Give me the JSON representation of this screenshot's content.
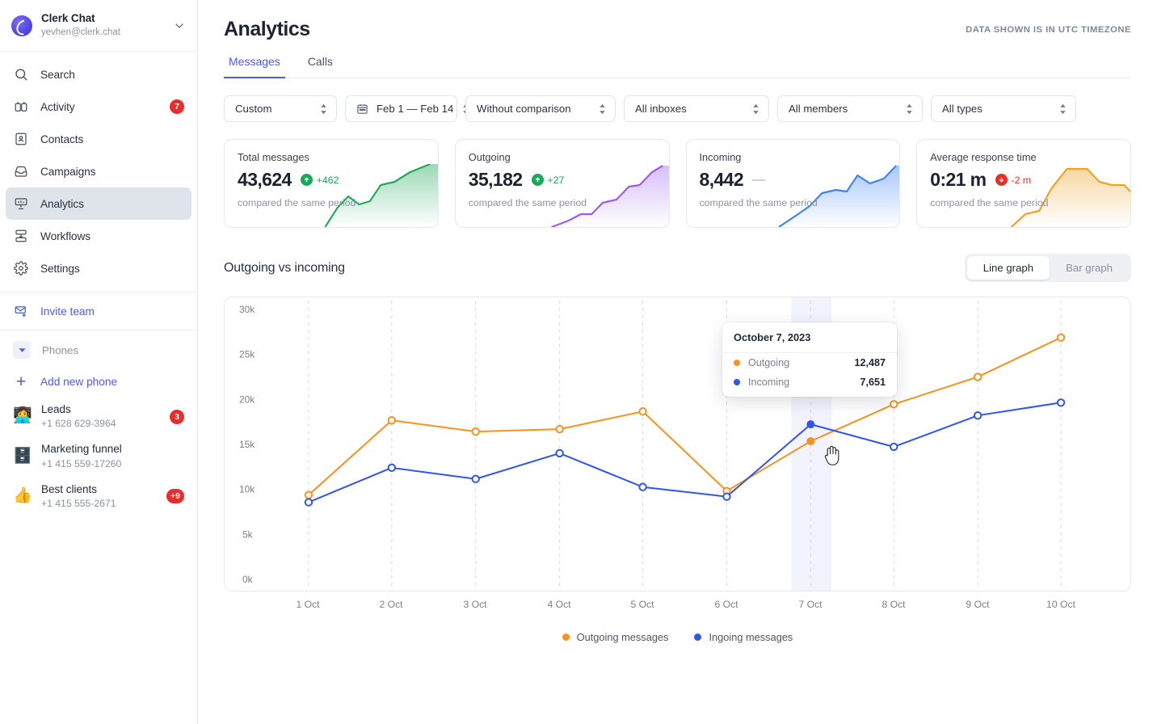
{
  "sidebar": {
    "workspace": {
      "name": "Clerk Chat",
      "email": "yevhen@clerk.chat",
      "logo_icon": "clerk-logo",
      "chevron_icon": "chevron-down-icon"
    },
    "items": [
      {
        "label": "Search",
        "icon": "search-icon",
        "badge": ""
      },
      {
        "label": "Activity",
        "icon": "activity-icon",
        "badge": "7"
      },
      {
        "label": "Contacts",
        "icon": "contacts-icon",
        "badge": ""
      },
      {
        "label": "Campaigns",
        "icon": "campaigns-icon",
        "badge": ""
      },
      {
        "label": "Analytics",
        "icon": "analytics-icon",
        "badge": "",
        "active": true
      },
      {
        "label": "Workflows",
        "icon": "workflows-icon",
        "badge": ""
      },
      {
        "label": "Settings",
        "icon": "settings-icon",
        "badge": ""
      }
    ],
    "invite": {
      "label": "Invite team",
      "icon": "mail-add-icon"
    },
    "phones_header": {
      "label": "Phones",
      "icon": "caret-down-icon"
    },
    "add_phone": {
      "label": "Add new phone",
      "icon": "plus-icon"
    },
    "phones": [
      {
        "emoji": "👩‍💻",
        "name": "Leads",
        "number": "+1 628 629-3964",
        "badge": "3"
      },
      {
        "emoji": "🗄️",
        "name": "Marketing funnel",
        "number": "+1 415 559-17260",
        "badge": ""
      },
      {
        "emoji": "👍",
        "name": "Best clients",
        "number": "+1 415 555-2671",
        "badge": "+9"
      }
    ]
  },
  "header": {
    "title": "Analytics",
    "utc_note": "DATA SHOWN IS IN UTC TIMEZONE",
    "tabs": [
      {
        "label": "Messages",
        "active": true
      },
      {
        "label": "Calls",
        "active": false
      }
    ]
  },
  "filters": [
    {
      "name": "range",
      "value": "Custom",
      "icon": ""
    },
    {
      "name": "date",
      "value": "Feb 1 — Feb 14",
      "icon": "calendar-icon"
    },
    {
      "name": "comparison",
      "value": "Without comparison",
      "icon": ""
    },
    {
      "name": "inboxes",
      "value": "All inboxes",
      "icon": ""
    },
    {
      "name": "members",
      "value": "All members",
      "icon": ""
    },
    {
      "name": "types",
      "value": "All types",
      "icon": ""
    }
  ],
  "cards": [
    {
      "title": "Total messages",
      "value": "43,624",
      "delta": "+462",
      "direction": "up",
      "sub": "compared the same period",
      "color": "#22a95c"
    },
    {
      "title": "Outgoing",
      "value": "35,182",
      "delta": "+27",
      "direction": "up",
      "sub": "compared the same period",
      "color": "#9a5cf0"
    },
    {
      "title": "Incoming",
      "value": "8,442",
      "delta": "—",
      "direction": "flat",
      "sub": "compared the same period",
      "color": "#3c82f6"
    },
    {
      "title": "Average response time",
      "value": "0:21 m",
      "delta": "-2 m",
      "direction": "down",
      "sub": "compared the same period",
      "color": "#f0a128"
    }
  ],
  "chart_section": {
    "title": "Outgoing vs incoming",
    "toggle": [
      {
        "label": "Line graph",
        "active": true
      },
      {
        "label": "Bar graph",
        "active": false
      }
    ]
  },
  "tooltip": {
    "date": "October 7, 2023",
    "rows": [
      {
        "label": "Outgoing",
        "value": "12,487",
        "color": "#f7921e"
      },
      {
        "label": "Incoming",
        "value": "7,651",
        "color": "#3355e8"
      }
    ]
  },
  "legend": [
    {
      "label": "Outgoing messages",
      "color": "#f7921e"
    },
    {
      "label": "Ingoing messages",
      "color": "#3355e8"
    }
  ],
  "chart_data": {
    "type": "line",
    "title": "Outgoing vs incoming",
    "xlabel": "",
    "ylabel": "",
    "x": [
      "1 Oct",
      "2 Oct",
      "3 Oct",
      "4 Oct",
      "5 Oct",
      "6 Oct",
      "7 Oct",
      "8 Oct",
      "9 Oct",
      "10 Oct"
    ],
    "ylim": [
      0,
      30000
    ],
    "yticks": [
      0,
      5000,
      10000,
      15000,
      20000,
      25000,
      30000
    ],
    "ytick_labels": [
      "0k",
      "5k",
      "10k",
      "15k",
      "20k",
      "25k",
      "30k"
    ],
    "grid": "vertical-dashed",
    "legend_position": "bottom-center",
    "highlight_x": "7 Oct",
    "series": [
      {
        "name": "Outgoing messages",
        "color": "#f7921e",
        "values": [
          9200,
          17500,
          16300,
          16500,
          18500,
          9600,
          12487,
          19300,
          22300,
          26700
        ]
      },
      {
        "name": "Ingoing messages",
        "color": "#3355e8",
        "values": [
          8400,
          12200,
          11000,
          13800,
          10100,
          9000,
          7651,
          14500,
          18000,
          19500
        ]
      }
    ]
  }
}
